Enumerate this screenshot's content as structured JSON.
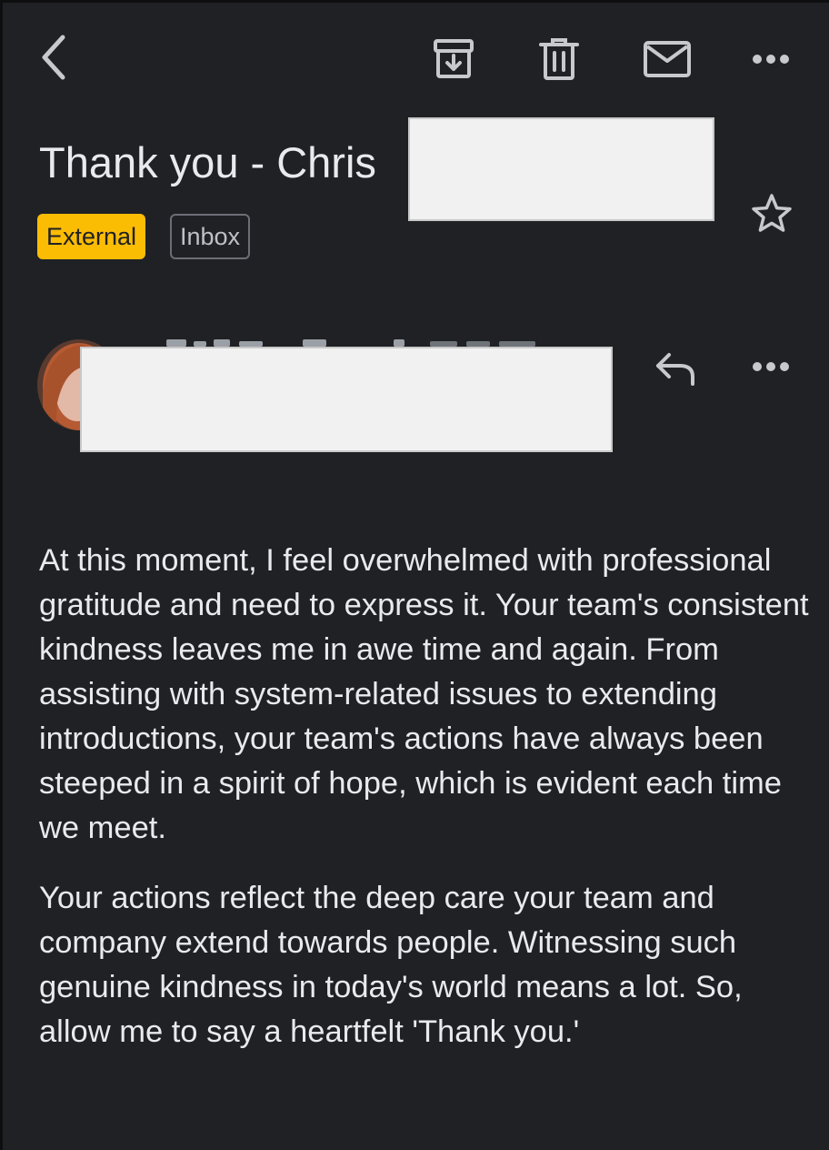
{
  "toolbar": {
    "back_icon": "chevron-left-icon",
    "archive_icon": "archive-icon",
    "delete_icon": "trash-icon",
    "unread_icon": "envelope-icon",
    "more_icon": "more-horizontal-icon"
  },
  "email": {
    "subject_visible": "Thank you - Chris",
    "labels": [
      "External",
      "Inbox"
    ],
    "label_colors": {
      "external_bg": "#fbbc04",
      "external_text": "#202124",
      "inbox_border": "#6b6f75"
    },
    "star_icon": "star-outline-icon",
    "reply_icon": "reply-icon",
    "body_paragraphs": [
      "At this moment, I feel overwhelmed with professional gratitude and need to express it. Your team's consistent kindness leaves me in awe time and again. From assisting with system-related issues to extending introductions, your team's actions have always been steeped in a spirit of hope, which is evident each time we meet.",
      "Your actions reflect the deep care your team and company extend towards people. Witnessing such genuine kindness in today's world means a lot. So, allow me to say a heartfelt 'Thank you.'"
    ]
  },
  "theme": {
    "background": "#202124",
    "text": "#e8eaed",
    "icon": "#c7c9cc"
  }
}
